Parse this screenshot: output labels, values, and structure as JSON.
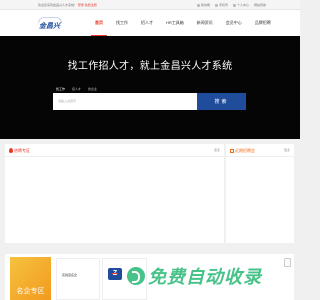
{
  "topbar": {
    "welcome": "欢迎您来到金昌兴人才系统！",
    "login": "登录",
    "register": "免费注册",
    "links": [
      "移动端",
      "手机号",
      "个人中心",
      "网站导航"
    ]
  },
  "logo": {
    "text": "金昌兴"
  },
  "nav": {
    "items": [
      "首页",
      "找工作",
      "招人才",
      "HR工具箱",
      "新闻资讯",
      "会员中心",
      "品牌招聘"
    ],
    "active_index": 0
  },
  "hero": {
    "slogan": "找工作招人才，就上金昌兴人才系统",
    "search_tabs": [
      "找工作",
      "招人才",
      "搜企业"
    ],
    "search_placeholder": "请输入关键字",
    "search_button": "搜索"
  },
  "panels": {
    "hot": {
      "title": "热聘专区",
      "more": "更多"
    },
    "fairs": {
      "title": "近期招聘会",
      "more": "更多"
    }
  },
  "famous": {
    "label": "名企专区",
    "card1": "实验室名企",
    "card2_mark": "Z"
  },
  "watermark": {
    "text": "免费自动收录"
  },
  "colors": {
    "accent": "#e8382a",
    "brand": "#1f4d9b",
    "hero_bg": "#050505"
  }
}
